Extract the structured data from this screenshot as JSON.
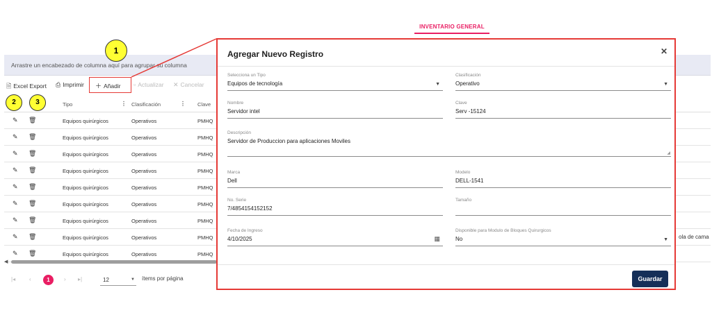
{
  "header": {
    "tab_title": "INVENTARIO GENERAL"
  },
  "grid": {
    "group_hint": "Arrastre un encabezado de columna aquí para agrupar su columna",
    "toolbar": {
      "excel_label": "Excel Export",
      "print_label": "Imprimir",
      "add_label": "Añadir",
      "update_label": "Actualizar",
      "cancel_label": "Cancelar"
    },
    "columns": [
      "Tipo",
      "Clasificación",
      "Clave"
    ],
    "rows": [
      {
        "tipo": "Equipos quirúrgicos",
        "clasificacion": "Operativos",
        "clave": "PMHQ"
      },
      {
        "tipo": "Equipos quirúrgicos",
        "clasificacion": "Operativos",
        "clave": "PMHQ"
      },
      {
        "tipo": "Equipos quirúrgicos",
        "clasificacion": "Operativos",
        "clave": "PMHQ"
      },
      {
        "tipo": "Equipos quirúrgicos",
        "clasificacion": "Operativos",
        "clave": "PMHQ"
      },
      {
        "tipo": "Equipos quirúrgicos",
        "clasificacion": "Operativos",
        "clave": "PMHQ"
      },
      {
        "tipo": "Equipos quirúrgicos",
        "clasificacion": "Operativos",
        "clave": "PMHQ"
      },
      {
        "tipo": "Equipos quirúrgicos",
        "clasificacion": "Operativos",
        "clave": "PMHQ"
      },
      {
        "tipo": "Equipos quirúrgicos",
        "clasificacion": "Operativos",
        "clave": "PMHQ"
      },
      {
        "tipo": "Equipos quirúrgicos",
        "clasificacion": "Operativos",
        "clave": "PMHQ"
      }
    ],
    "row_extra_text": "ola de cama",
    "pager": {
      "current_page": "1",
      "page_size": "12",
      "items_label": "ítems por página"
    }
  },
  "annotations": {
    "badge_1": "1",
    "badge_2": "2",
    "badge_3": "3"
  },
  "modal": {
    "title": "Agregar Nuevo Registro",
    "fields": {
      "tipo": {
        "label": "Selecciona un Tipo",
        "value": "Equipos de tecnología"
      },
      "clasificacion": {
        "label": "Clasificación",
        "value": "Operativo"
      },
      "nombre": {
        "label": "Nombre",
        "value": "Servidor intel"
      },
      "clave": {
        "label": "Clave",
        "value": "Serv -15124"
      },
      "descripcion": {
        "label": "Descripción",
        "value": "Servidor de Produccion para aplicaciones Moviles"
      },
      "marca": {
        "label": "Marca",
        "value": "Dell"
      },
      "modelo": {
        "label": "Modelo",
        "value": "DELL-1541"
      },
      "serie": {
        "label": "No. Serie",
        "value": "7/4854154152152"
      },
      "tamano": {
        "label": "Tamaño",
        "value": ""
      },
      "fecha": {
        "label": "Fecha de Ingreso",
        "value": "4/10/2025"
      },
      "disponible": {
        "label": "Disponible para Modulo de Bloques Quirurgicos",
        "value": "No"
      }
    },
    "save_label": "Guardar"
  },
  "colors": {
    "accent": "#e91e63",
    "highlight": "#e53935",
    "primary_button": "#152f58",
    "badge": "#ffff33"
  }
}
